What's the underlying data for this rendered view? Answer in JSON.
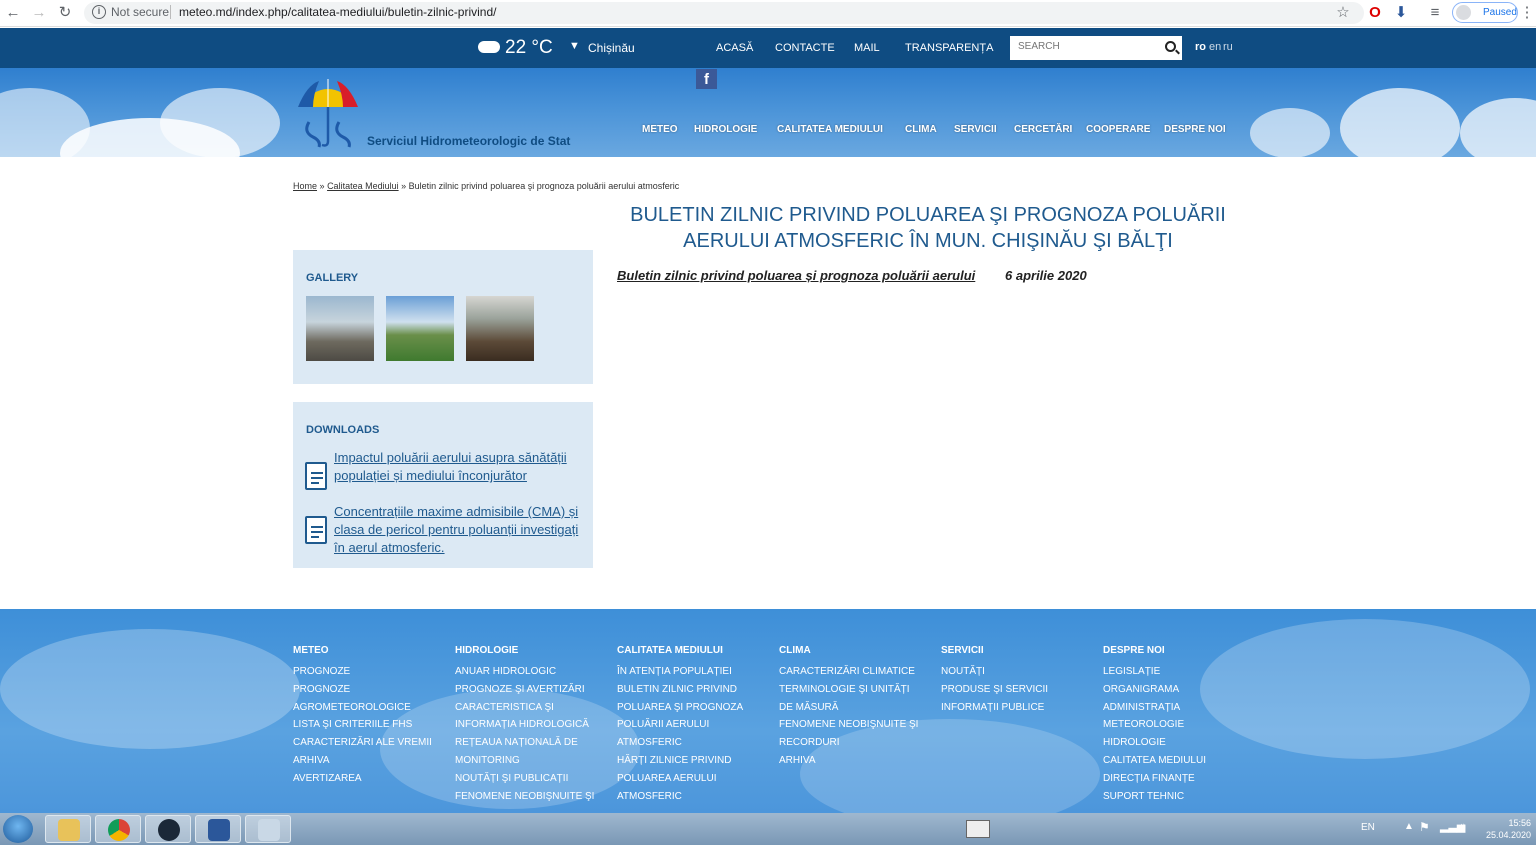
{
  "browser": {
    "security": "Not secure",
    "url": "meteo.md/index.php/calitatea-mediului/buletin-zilnic-privind/",
    "profile_status": "Paused"
  },
  "topbar": {
    "temperature": "22 °C",
    "city": "Chișinău",
    "menu": [
      "ACASĂ",
      "CONTACTE",
      "MAIL",
      "TRANSPARENȚA"
    ],
    "search_placeholder": "SEARCH",
    "languages": [
      "ro",
      "en",
      "ru"
    ]
  },
  "header": {
    "site_name": "Serviciul Hidrometeorologic de Stat",
    "menu": [
      "METEO",
      "HIDROLOGIE",
      "CALITATEA MEDIULUI",
      "CLIMA",
      "SERVICII",
      "CERCETĂRI",
      "COOPERARE",
      "DESPRE NOI"
    ]
  },
  "breadcrumb": {
    "home": "Home",
    "sep1": "»",
    "section": "Calitatea Mediului",
    "sep2": "»",
    "current": "Buletin zilnic privind poluarea şi prognoza poluării aerului atmosferic"
  },
  "page": {
    "title_line1": "BULETIN ZILNIC PRIVIND POLUAREA ŞI PROGNOZA POLUĂRII",
    "title_line2": "AERULUI ATMOSFERIC ÎN MUN. CHIŞINĂU ŞI BĂLŢI",
    "article_link": "Buletin zilnic privind poluarea și prognoza poluării aerului ",
    "article_date": "6 aprilie 2020"
  },
  "sidebar": {
    "gallery_title": "GALLERY",
    "downloads_title": "DOWNLOADS",
    "downloads": [
      "Impactul poluării aerului asupra sănătății populației și mediului înconjurător",
      "Concentrațiile maxime admisibile (CMA) și clasa de pericol pentru poluanții investigați în aerul atmosferic."
    ]
  },
  "footer": {
    "columns": [
      {
        "title": "METEO",
        "items": [
          "PROGNOZE",
          "PROGNOZE",
          "AGROMETEOROLOGICE",
          "LISTA ŞI CRITERIILE FHS",
          "CARACTERIZĂRI ALE VREMII",
          "ARHIVA",
          "AVERTIZAREA"
        ]
      },
      {
        "title": "HIDROLOGIE",
        "items": [
          "ANUAR HIDROLOGIC",
          "PROGNOZE ŞI AVERTIZĂRI",
          "CARACTERISTICA ŞI",
          "INFORMAȚIA HIDROLOGICĂ",
          "REȚEAUA NAȚIONALĂ DE",
          "MONITORING",
          "NOUTĂȚI ŞI PUBLICAȚII",
          "FENOMENE NEOBIŞNUITE ŞI"
        ]
      },
      {
        "title": "CALITATEA MEDIULUI",
        "items": [
          "ÎN ATENȚIA POPULAȚIEI",
          "BULETIN ZILNIC PRIVIND",
          "POLUAREA ŞI PROGNOZA",
          "POLUĂRII AERULUI",
          "ATMOSFERIC",
          "HĂRȚI ZILNICE PRIVIND",
          "POLUAREA AERULUI",
          "ATMOSFERIC"
        ]
      },
      {
        "title": "CLIMA",
        "items": [
          "CARACTERIZĂRI CLIMATICE",
          "TERMINOLOGIE ŞI UNITĂȚI",
          "DE MĂSURĂ",
          "FENOMENE NEOBIŞNUITE ŞI",
          "RECORDURI",
          "ARHIVA"
        ]
      },
      {
        "title": "SERVICII",
        "items": [
          "NOUTĂȚI",
          "PRODUSE ŞI SERVICII",
          "INFORMAȚII PUBLICE"
        ]
      },
      {
        "title": "DESPRE NOI",
        "items": [
          "LEGISLAȚIE",
          "ORGANIGRAMA",
          "ADMINISTRAȚIA",
          "METEOROLOGIE",
          "HIDROLOGIE",
          "CALITATEA MEDIULUI",
          "DIRECȚIA FINANȚE",
          "SUPORT TEHNIC"
        ]
      }
    ]
  },
  "taskbar": {
    "lang": "EN",
    "time": "15:56",
    "date": "25.04.2020"
  }
}
